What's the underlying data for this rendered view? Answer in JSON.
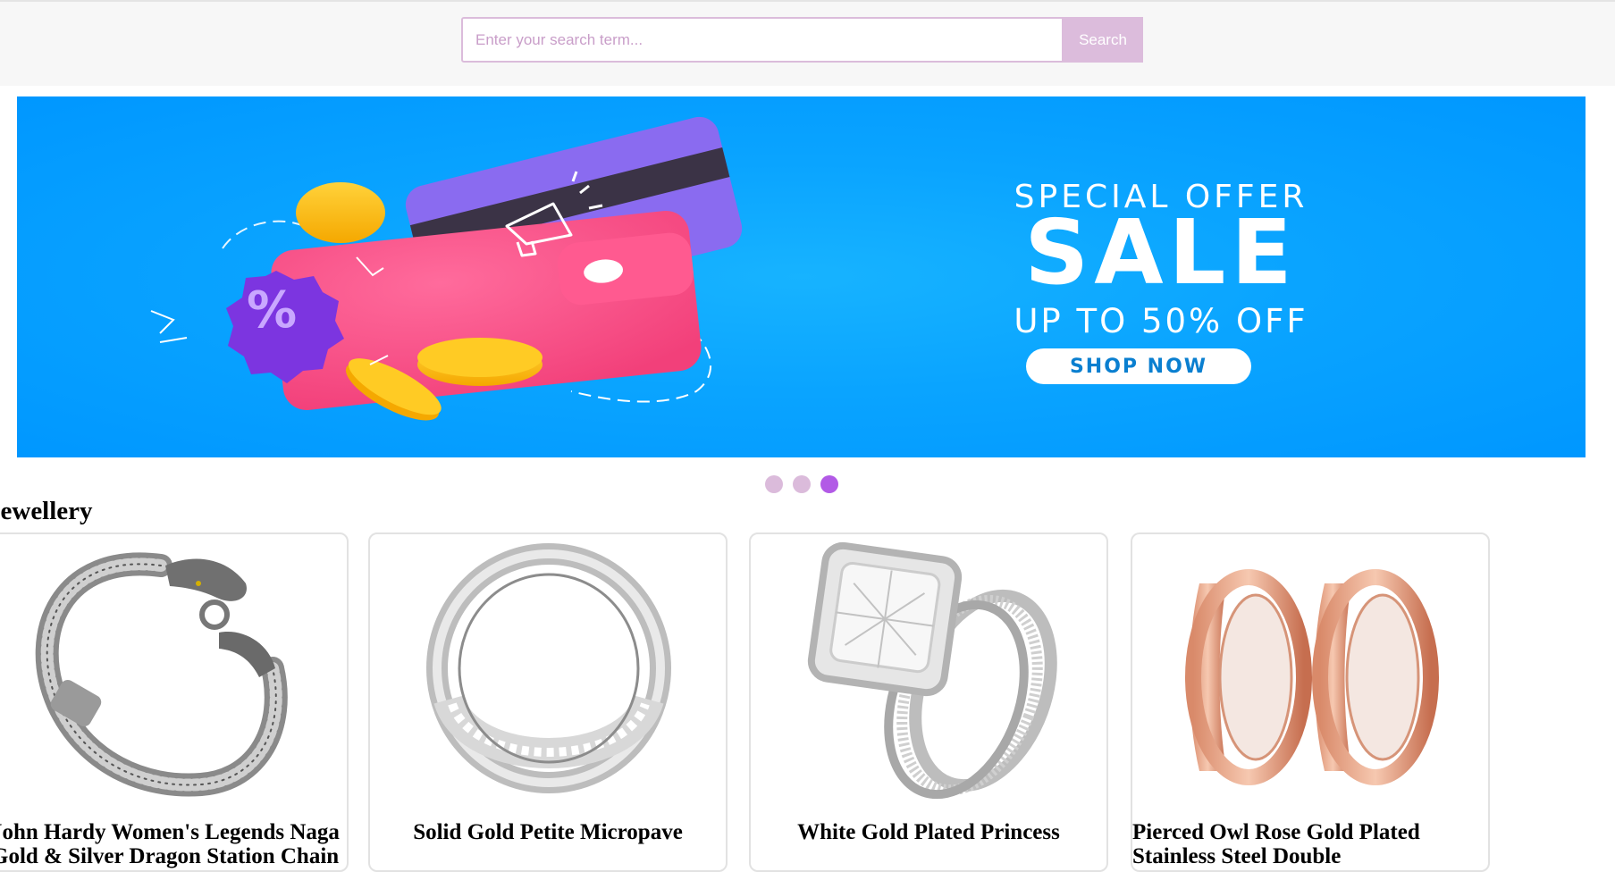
{
  "search": {
    "placeholder": "Enter your search term...",
    "button_label": "Search"
  },
  "banner": {
    "line1": "SPECIAL OFFER",
    "line2": "SALE",
    "line3": "UP TO 50% OFF",
    "cta": "SHOP NOW",
    "badge": "%",
    "colors": {
      "background": "#0aa4ff",
      "wallet": "#ff4f8b",
      "card": "#8a6bf0",
      "coin": "#ffc21a",
      "badge": "#7c35e0"
    }
  },
  "carousel": {
    "slides": 3,
    "active_index": 3
  },
  "section": {
    "title": "Jewellery"
  },
  "products": [
    {
      "title": "John Hardy Women's Legends Naga Gold & Silver Dragon Station Chain",
      "image": "bracelet-image"
    },
    {
      "title": "Solid Gold Petite Micropave",
      "image": "ring-image"
    },
    {
      "title": "White Gold Plated Princess",
      "image": "engagement-ring-image"
    },
    {
      "title": "Pierced Owl Rose Gold Plated Stainless Steel Double",
      "image": "rose-gold-tunnel-image"
    }
  ],
  "colors": {
    "accent": "#dcbcdc",
    "active_dot": "#b25ae6",
    "header_bg": "#f7f7f7"
  }
}
